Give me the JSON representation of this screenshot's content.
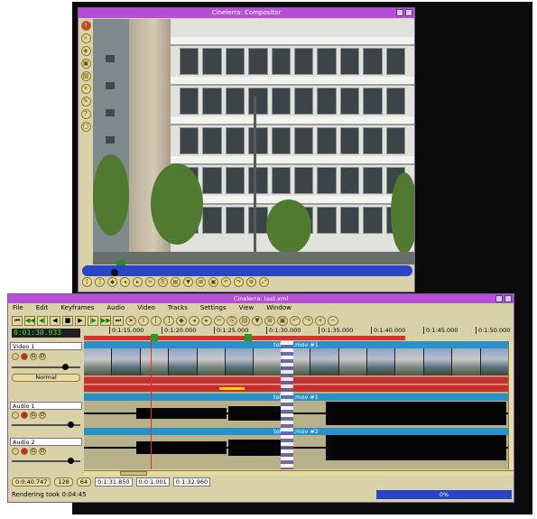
{
  "compositor": {
    "title": "Cinelerra: Compositor"
  },
  "main": {
    "title": "Cinelerra: test.xml",
    "menu": [
      "File",
      "Edit",
      "Keyframes",
      "Audio",
      "Video",
      "Tracks",
      "Settings",
      "View",
      "Window"
    ],
    "timecode": "0:01:30.933",
    "ruler_ticks": [
      "0:1:15.000",
      "0:1:20.000",
      "0:1:25.000",
      "0:1:30.000",
      "0:1:35.000",
      "0:1:40.000",
      "0:1:45.000",
      "0:1:50.000"
    ],
    "tracks": {
      "video1": {
        "name": "Video 1",
        "mode": "Normal",
        "clip": "tokyo3.mov #1"
      },
      "audio1": {
        "name": "Audio 1",
        "clip": "tokyo3.mov #1"
      },
      "audio2": {
        "name": "Audio 2",
        "clip": "tokyo3.mov #2"
      }
    },
    "bottom": {
      "length": "0:0:40.747",
      "zoom_samples": "128",
      "zoom_amp": "64",
      "selection_start": "0:1:31.850",
      "selection_length": "0:0:1.001",
      "selection_end": "0:1:32.960"
    },
    "status": "Rendering took 0:04:45",
    "progress_label": "0%",
    "progress": 0
  },
  "icons": {
    "track_buttons": [
      "play-toggle",
      "record-toggle",
      "gang",
      "draw"
    ],
    "transport": [
      "rewind",
      "frame-back",
      "play-back",
      "stop",
      "play",
      "frame-forward",
      "fast-forward",
      "end"
    ]
  }
}
